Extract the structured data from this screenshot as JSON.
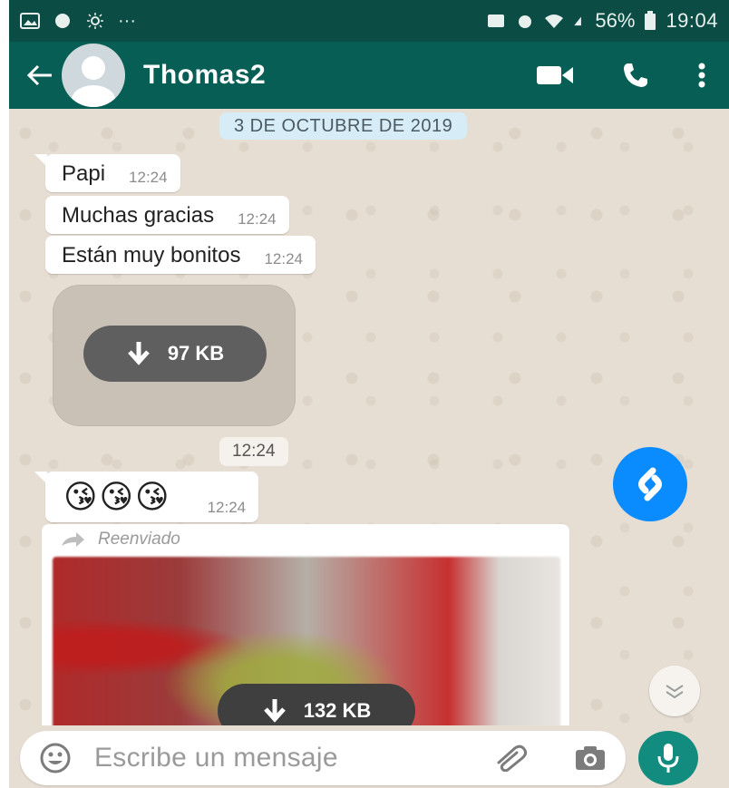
{
  "status_bar": {
    "battery": "56%",
    "time": "19:04"
  },
  "header": {
    "contact_name": "Thomas2"
  },
  "chat": {
    "date_chip": "3 DE OCTUBRE DE 2019",
    "messages": [
      {
        "text": "Papi",
        "time": "12:24"
      },
      {
        "text": "Muchas gracias",
        "time": "12:24"
      },
      {
        "text": "Están muy bonitos",
        "time": "12:24"
      }
    ],
    "media_download_size": "97 KB",
    "media_time": "12:24",
    "emoji_message": {
      "emojis": "😘😘😘",
      "time": "12:24"
    },
    "forwarded": {
      "label": "Reenviado",
      "download_size": "132 KB"
    }
  },
  "composer": {
    "placeholder": "Escribe un mensaje"
  },
  "colors": {
    "header": "#075e54",
    "status_bar": "#0b4d45",
    "mic_button": "#128c7e",
    "shazam": "#0a8cff"
  },
  "icons": [
    "back-arrow-icon",
    "video-call-icon",
    "phone-icon",
    "more-vert-icon",
    "download-icon",
    "forward-icon",
    "shazam-icon",
    "chevron-double-down-icon",
    "emoji-icon",
    "attach-icon",
    "camera-icon",
    "mic-icon"
  ]
}
